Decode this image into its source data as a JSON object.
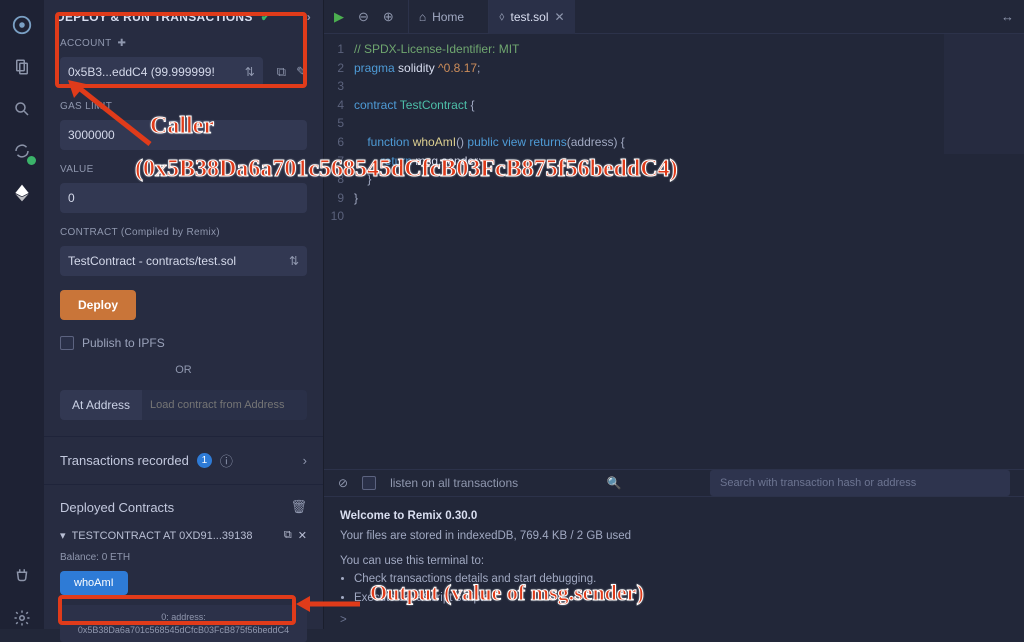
{
  "panel": {
    "title": "DEPLOY & RUN TRANSACTIONS",
    "account_label": "ACCOUNT",
    "account_value": "0x5B3...eddC4 (99.999999!",
    "gaslimit_label": "GAS LIMIT",
    "gaslimit_value": "3000000",
    "value_label": "VALUE",
    "value_value": "0",
    "contract_label": "CONTRACT (Compiled by Remix)",
    "contract_value": "TestContract - contracts/test.sol",
    "deploy": "Deploy",
    "publish_ipfs": "Publish to IPFS",
    "or": "OR",
    "at_address": "At Address",
    "at_address_placeholder": "Load contract from Address",
    "tx_recorded": "Transactions recorded",
    "tx_badge": "1",
    "deployed_header": "Deployed Contracts",
    "deployed_item": "TESTCONTRACT AT 0XD91...39138",
    "balance": "Balance: 0 ETH",
    "fn_name": "whoAmI",
    "output": "0:  address: 0x5B38Da6a701c568545dCfcB03FcB875f56beddC4"
  },
  "tabs": {
    "home": "Home",
    "file": "test.sol"
  },
  "code": {
    "lines": [
      "1",
      "2",
      "3",
      "4",
      "5",
      "6",
      "7",
      "8",
      "9",
      "10"
    ],
    "l1": "// SPDX-License-Identifier: MIT",
    "l2a": "pragma",
    "l2b": " solidity ",
    "l2c": "^0.8.17",
    "l2d": ";",
    "l4a": "contract",
    "l4b": " TestContract ",
    "l4c": "{",
    "l6a": "    function",
    "l6b": " whoAmI",
    "l6c": "() ",
    "l6d": "public view returns",
    "l6e": "(address) {",
    "l7a": "        return",
    "l7b": " msg.sender;",
    "l8": "    }",
    "l9": "}"
  },
  "bottom": {
    "listen": "listen on all transactions",
    "search_placeholder": "Search with transaction hash or address",
    "welcome": "Welcome to Remix 0.30.0",
    "storage": "Your files are stored in indexedDB, 769.4 KB / 2 GB used",
    "hint": "You can use this terminal to:",
    "b1": "Check transactions details and start debugging.",
    "b2": "Execute JavaScript scripts.",
    "prompt": ">"
  },
  "annotations": {
    "caller1": "Caller",
    "caller2": "(0x5B38Da6a701c568545dCfcB03FcB875f56beddC4)",
    "output": "Output (value of msg.sender)"
  }
}
